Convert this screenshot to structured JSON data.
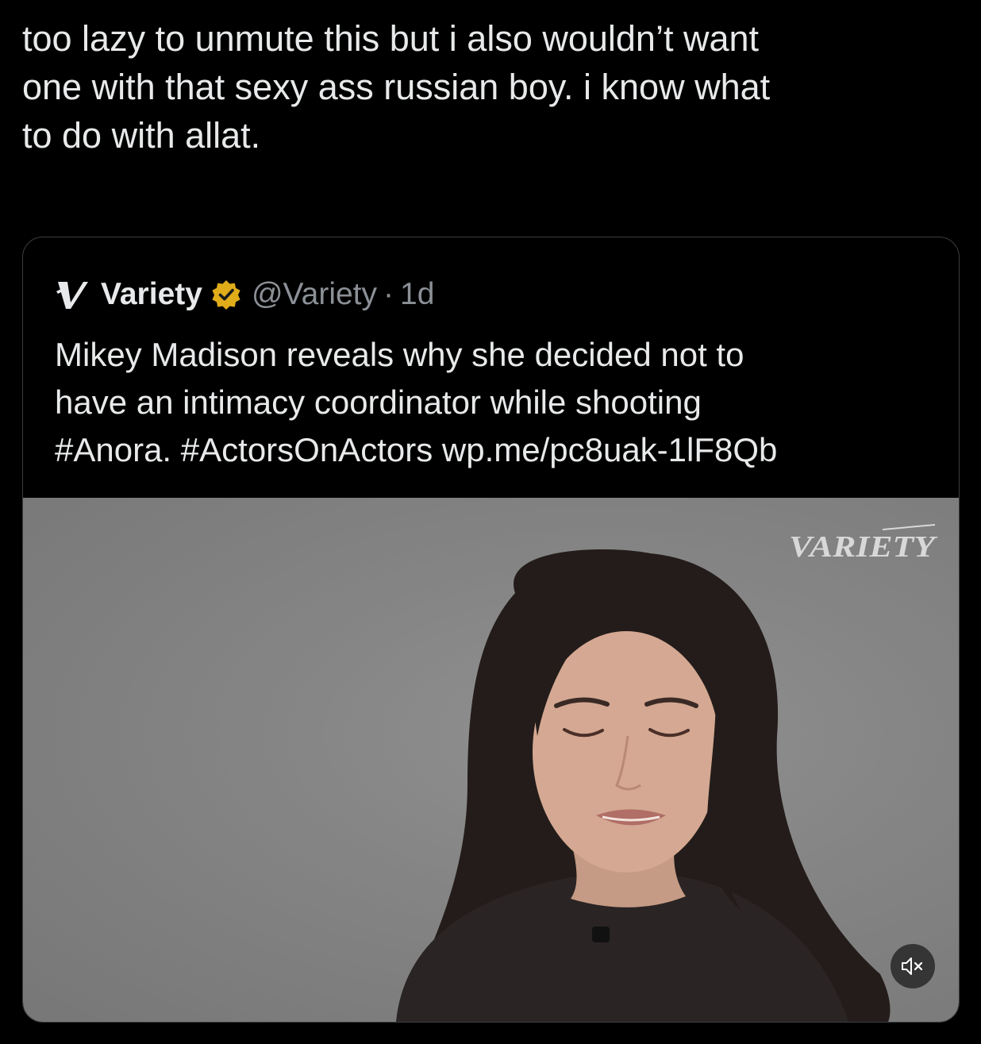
{
  "tweet": {
    "text": "too lazy to unmute this but i also wouldn’t want\none with that sexy ass russian boy. i know what\nto do with allat."
  },
  "quoted_tweet": {
    "author_name": "Variety",
    "handle": "@Variety",
    "separator": "·",
    "time": "1d",
    "verified": true,
    "text": "Mikey Madison reveals why she decided not to\nhave an intimacy coordinator while shooting\n#Anora. #ActorsOnActors wp.me/pc8uak-1lF8Qb",
    "media": {
      "type": "video",
      "watermark": "VARIETY",
      "muted": true
    }
  },
  "icons": {
    "avatar": "variety-v-logo-icon",
    "badge": "verified-badge-icon",
    "mute": "speaker-muted-icon"
  },
  "colors": {
    "background": "#000000",
    "text": "#e7e9ea",
    "secondary_text": "#8b9096",
    "badge": "#e0ac1a",
    "card_border": "#3a3d41"
  }
}
